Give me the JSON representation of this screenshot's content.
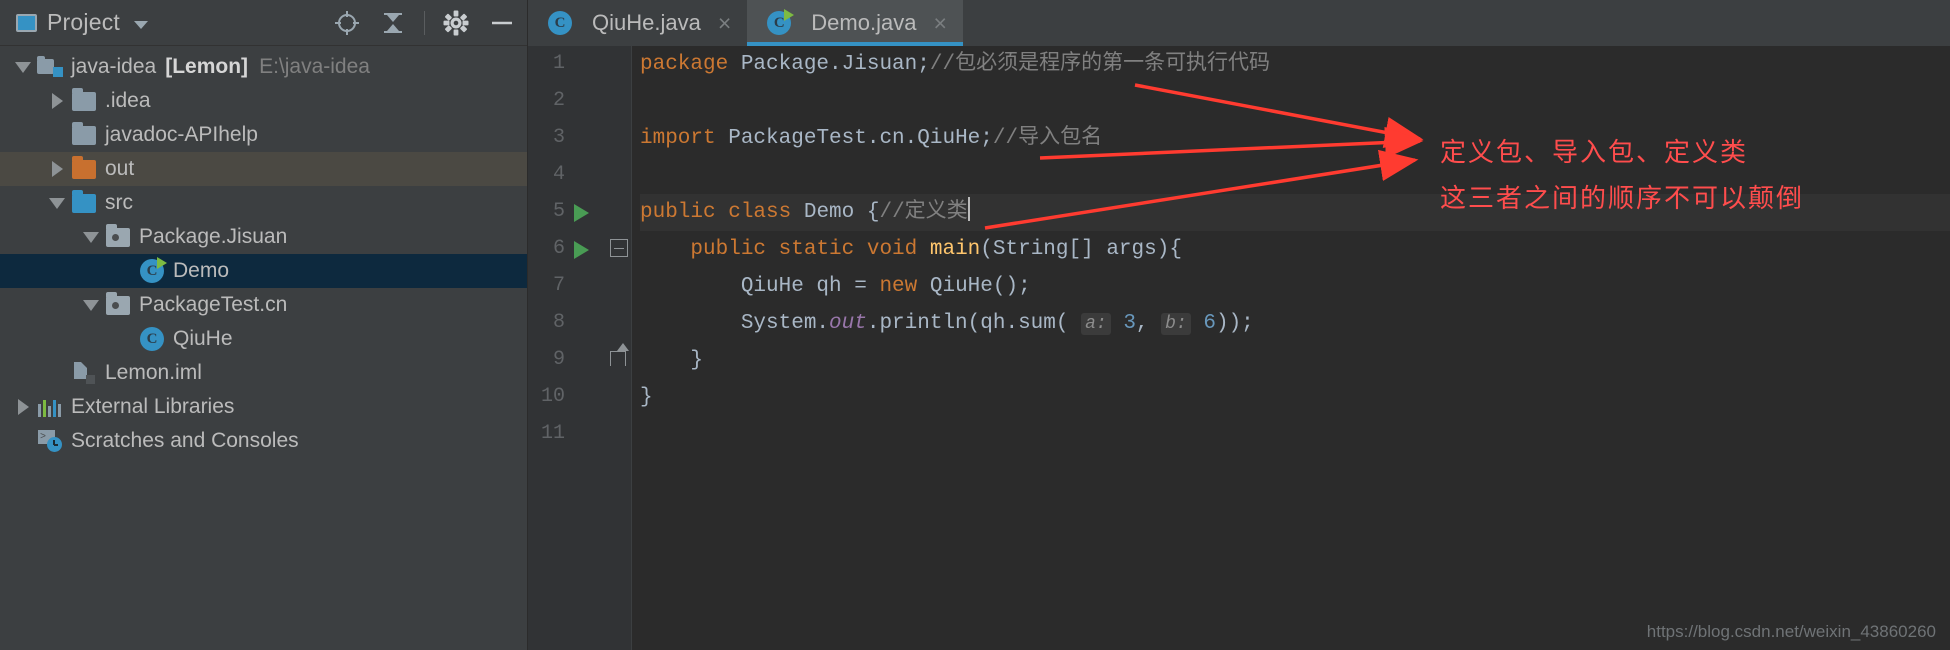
{
  "window": {
    "theme_bg": "#3c3f41",
    "editor_bg": "#2b2b2b",
    "accent": "#3592c4",
    "annotation_color": "#ff4d4d"
  },
  "sidebar": {
    "title": "Project",
    "icons": {
      "project": "project-window-icon",
      "dropdown": "chevron-down-icon",
      "locate": "scroll-from-source-icon",
      "collapse": "collapse-all-icon",
      "settings": "gear-icon",
      "hide": "minimize-icon"
    },
    "tree": [
      {
        "label": "java-idea",
        "bold_label": "[Lemon]",
        "path": "E:\\java-idea",
        "icon": "project-root-icon",
        "arrow": "down",
        "indent": 0,
        "state": "normal"
      },
      {
        "label": ".idea",
        "icon": "folder-grey-icon",
        "arrow": "right",
        "indent": 1,
        "state": "normal"
      },
      {
        "label": "javadoc-APIhelp",
        "icon": "folder-grey-icon",
        "arrow": "none",
        "indent": 1,
        "state": "normal"
      },
      {
        "label": "out",
        "icon": "folder-orange-icon",
        "arrow": "right",
        "indent": 1,
        "state": "olive"
      },
      {
        "label": "src",
        "icon": "folder-blue-icon",
        "arrow": "down",
        "indent": 1,
        "state": "normal"
      },
      {
        "label": "Package.Jisuan",
        "icon": "package-icon",
        "arrow": "down",
        "indent": 2,
        "state": "normal"
      },
      {
        "label": "Demo",
        "icon": "java-class-runnable-icon",
        "arrow": "none",
        "indent": 3,
        "state": "selected"
      },
      {
        "label": "PackageTest.cn",
        "icon": "package-icon",
        "arrow": "down",
        "indent": 2,
        "state": "normal"
      },
      {
        "label": "QiuHe",
        "icon": "java-class-icon",
        "arrow": "none",
        "indent": 3,
        "state": "normal"
      },
      {
        "label": "Lemon.iml",
        "icon": "iml-file-icon",
        "arrow": "none",
        "indent": 1,
        "state": "normal"
      },
      {
        "label": "External Libraries",
        "icon": "libraries-icon",
        "arrow": "right",
        "indent": 0,
        "state": "normal"
      },
      {
        "label": "Scratches and Consoles",
        "icon": "scratches-icon",
        "arrow": "none",
        "indent": 0,
        "state": "normal"
      }
    ]
  },
  "editor": {
    "tabs": [
      {
        "label": "QiuHe.java",
        "icon": "java-class-icon",
        "active": false,
        "close": "×"
      },
      {
        "label": "Demo.java",
        "icon": "java-class-runnable-icon",
        "active": true,
        "close": "×"
      }
    ],
    "lines": [
      {
        "number": "1",
        "gutter": {
          "run": false,
          "fold": "none"
        },
        "tokens": [
          {
            "t": "package",
            "c": "kw"
          },
          {
            "t": " Package.Jisuan;",
            "c": "id"
          },
          {
            "t": "//包必须是程序的第一条可执行代码",
            "c": "cm"
          }
        ]
      },
      {
        "number": "2",
        "gutter": {
          "run": false,
          "fold": "none"
        },
        "tokens": []
      },
      {
        "number": "3",
        "gutter": {
          "run": false,
          "fold": "none"
        },
        "tokens": [
          {
            "t": "import",
            "c": "kw"
          },
          {
            "t": " PackageTest.cn.QiuHe;",
            "c": "id"
          },
          {
            "t": "//导入包名",
            "c": "cm"
          }
        ]
      },
      {
        "number": "4",
        "gutter": {
          "run": false,
          "fold": "none"
        },
        "bulb": true,
        "tokens": []
      },
      {
        "number": "5",
        "gutter": {
          "run": true,
          "fold": "none"
        },
        "highlight": true,
        "caret": true,
        "tokens": [
          {
            "t": "public class",
            "c": "kw"
          },
          {
            "t": " Demo ",
            "c": "id"
          },
          {
            "t": "{",
            "c": "id"
          },
          {
            "t": "//定义类",
            "c": "cm"
          }
        ]
      },
      {
        "number": "6",
        "gutter": {
          "run": true,
          "fold": "minus"
        },
        "tokens": [
          {
            "t": "    ",
            "c": "id"
          },
          {
            "t": "public static void",
            "c": "kw"
          },
          {
            "t": " ",
            "c": "id"
          },
          {
            "t": "main",
            "c": "fn"
          },
          {
            "t": "(String[] args){",
            "c": "id"
          }
        ]
      },
      {
        "number": "7",
        "gutter": {
          "run": false,
          "fold": "none"
        },
        "tokens": [
          {
            "t": "        QiuHe qh = ",
            "c": "id"
          },
          {
            "t": "new",
            "c": "kw"
          },
          {
            "t": " QiuHe();",
            "c": "id"
          }
        ]
      },
      {
        "number": "8",
        "gutter": {
          "run": false,
          "fold": "none"
        },
        "tokens": [
          {
            "t": "        System.",
            "c": "id"
          },
          {
            "t": "out",
            "c": "st"
          },
          {
            "t": ".println(qh.sum( ",
            "c": "id"
          },
          {
            "t": "a:",
            "c": "hint"
          },
          {
            "t": " ",
            "c": "id"
          },
          {
            "t": "3",
            "c": "num"
          },
          {
            "t": ", ",
            "c": "id"
          },
          {
            "t": "b:",
            "c": "hint"
          },
          {
            "t": " ",
            "c": "id"
          },
          {
            "t": "6",
            "c": "num"
          },
          {
            "t": "));",
            "c": "id"
          }
        ]
      },
      {
        "number": "9",
        "gutter": {
          "run": false,
          "fold": "end"
        },
        "tokens": [
          {
            "t": "    }",
            "c": "id"
          }
        ]
      },
      {
        "number": "10",
        "gutter": {
          "run": false,
          "fold": "none"
        },
        "tokens": [
          {
            "t": "}",
            "c": "id"
          }
        ]
      },
      {
        "number": "11",
        "gutter": {
          "run": false,
          "fold": "none"
        },
        "tokens": []
      }
    ]
  },
  "annotations": {
    "line1": "定义包、导入包、定义类",
    "line2": "这三者之间的顺序不可以颠倒"
  },
  "watermark": "https://blog.csdn.net/weixin_43860260"
}
